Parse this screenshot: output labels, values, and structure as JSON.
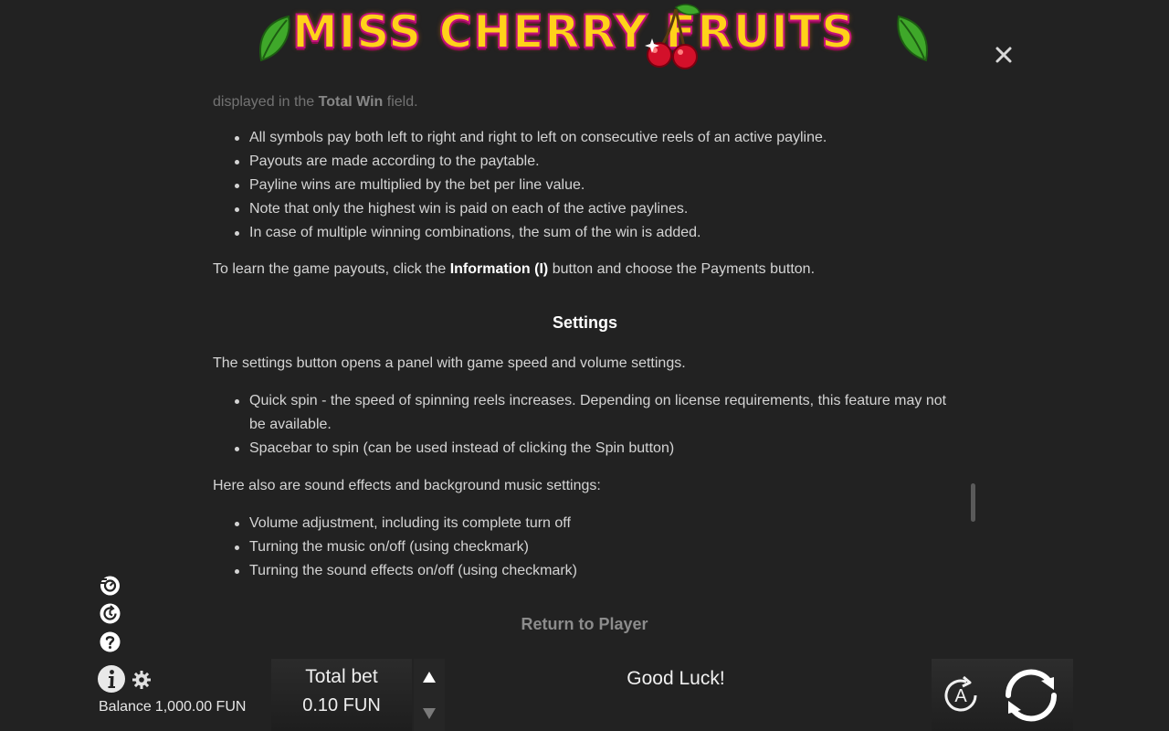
{
  "logo": {
    "text": "MISS CHERRY FRUITS"
  },
  "rules": {
    "faded_line_start": "displayed in the ",
    "faded_line_bold": "Total Win",
    "faded_line_end": " field.",
    "win_bullets": [
      "All symbols pay both left to right and right to left on consecutive reels of an active payline.",
      "Payouts are made according to the paytable.",
      "Payline wins are multiplied by the bet per line value.",
      "Note that only the highest win is paid on each of the active paylines.",
      "In case of multiple winning combinations, the sum of the win is added."
    ],
    "payouts_start": "To learn the game payouts, click the ",
    "payouts_bold": "Information (I)",
    "payouts_end": " button and choose the Payments button.",
    "settings_title": "Settings",
    "settings_intro": "The settings button opens a panel with game speed and volume settings.",
    "settings_bullet_1_line_1": "Quick spin - the speed of spinning reels increases. Depending on license requirements, this feature may not",
    "settings_bullet_1_line_2": "be available.",
    "settings_bullet_2": "Spacebar to spin (can be used instead of clicking the Spin button)",
    "sound_intro": "Here also are sound effects and background music settings:",
    "sound_bullets": [
      "Volume adjustment, including its complete turn off",
      "Turning the music on/off (using checkmark)",
      "Turning the sound effects on/off (using checkmark)"
    ],
    "return_label": "Return to Player"
  },
  "bottom": {
    "balance_label": "Balance",
    "balance_value": "1,000.00 FUN",
    "total_bet_label": "Total bet",
    "total_bet_value": "0.10 FUN",
    "message": "Good Luck!",
    "auto_letter": "A"
  },
  "colors": {
    "background": "#222222",
    "logo_yellow": "#ffd21a",
    "logo_outline": "#c2127a",
    "text": "#d4d4d4"
  }
}
